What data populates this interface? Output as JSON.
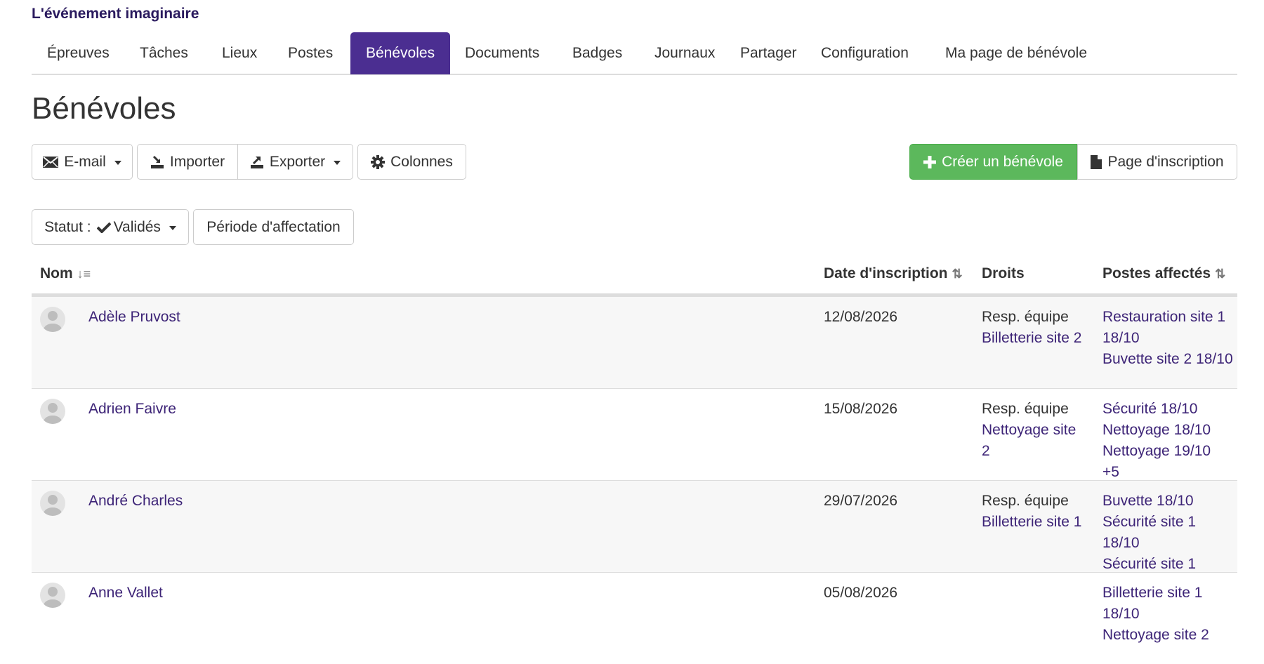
{
  "brand": "L'événement imaginaire",
  "tabs": [
    {
      "label": "Épreuves"
    },
    {
      "label": "Tâches"
    },
    {
      "label": "Lieux"
    },
    {
      "label": "Postes"
    },
    {
      "label": "Bénévoles",
      "active": true
    },
    {
      "label": "Documents"
    },
    {
      "label": "Badges"
    },
    {
      "label": "Journaux"
    },
    {
      "label": "Partager"
    },
    {
      "label": "Configuration"
    },
    {
      "label": "Ma page de bénévole"
    }
  ],
  "page_title": "Bénévoles",
  "toolbar": {
    "email": "E-mail",
    "import": "Importer",
    "export": "Exporter",
    "columns": "Colonnes",
    "create": "Créer un bénévole",
    "signup_page": "Page d'inscription"
  },
  "filters": {
    "status_prefix": "Statut :",
    "status_value": "Validés",
    "period": "Période d'affectation"
  },
  "table": {
    "headers": {
      "name": "Nom",
      "date": "Date d'inscription",
      "rights": "Droits",
      "posts": "Postes affectés"
    },
    "rows": [
      {
        "name": "Adèle Pruvost",
        "date": "12/08/2026",
        "rights_role": "Resp. équipe",
        "rights_team": "Billetterie site 2",
        "posts": [
          "Restauration site 1 18/10",
          "Buvette site 2 18/10"
        ]
      },
      {
        "name": "Adrien Faivre",
        "date": "15/08/2026",
        "rights_role": "Resp. équipe",
        "rights_team": "Nettoyage site 2",
        "posts": [
          "Sécurité 18/10",
          "Nettoyage 18/10",
          "Nettoyage 19/10",
          "+5"
        ]
      },
      {
        "name": "André Charles",
        "date": "29/07/2026",
        "rights_role": "Resp. équipe",
        "rights_team": "Billetterie site 1",
        "posts": [
          "Buvette 18/10",
          "Sécurité site 1 18/10",
          "Sécurité site 1"
        ]
      },
      {
        "name": "Anne Vallet",
        "date": "05/08/2026",
        "rights_role": "",
        "rights_team": "",
        "posts": [
          "Billetterie site 1 18/10",
          "Nettoyage site 2"
        ]
      }
    ]
  },
  "colors": {
    "accent": "#4b2e91",
    "success": "#5cb85c",
    "link": "#3d2477"
  }
}
